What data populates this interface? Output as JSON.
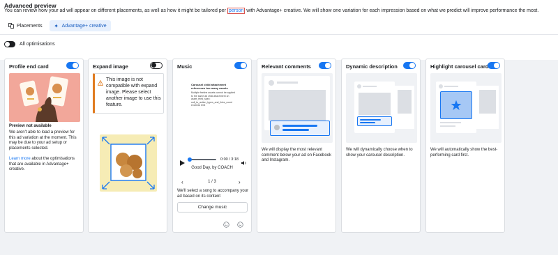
{
  "header": {
    "title": "Advanced preview",
    "description_before": "You can review how your ad will appear on different placements, as well as how it might be tailored per ",
    "description_highlight": "person",
    "description_after": " with Advantage+ creative. We will show one variation for each impression based on what we predict will improve performance the most."
  },
  "tabs": [
    {
      "label": "Placements",
      "icon": "placements-icon",
      "active": false
    },
    {
      "label": "Advantage+ creative",
      "icon": "sparkle-icon",
      "active": true
    }
  ],
  "all_optimisations": {
    "label": "All optimisations",
    "enabled": false
  },
  "cards": {
    "profile": {
      "title": "Profile end card",
      "enabled": true,
      "status": "Preview not available",
      "text": "We aren't able to load a preview for this ad variation at the moment. This may be due to your ad setup or placements selected.",
      "link": "Learn more",
      "text2": " about the optimisations that are available in Advantage+ creative."
    },
    "expand": {
      "title": "Expand image",
      "enabled": false,
      "warning": "This image is not compatible with expand image. Please select another image to use this feature."
    },
    "music": {
      "title": "Music",
      "enabled": true,
      "mini_text_1": "Carousel child attachment references too many assets",
      "mini_text_2": "Multiple feeline assets cannot be applied to the same ad child attachment on asset_feed_spec: call_to_action_types_and_links_count exceeds limit",
      "time": "0:00 / 3:18",
      "song": "Good Day, by COACH",
      "page": "1 / 3",
      "note": "We'll select a song to accompany your ad based on its content",
      "button": "Change music"
    },
    "comments": {
      "title": "Relevant comments",
      "enabled": true,
      "text": "We will display the most relevant comment below your ad on Facebook and Instagram."
    },
    "dynamic": {
      "title": "Dynamic description",
      "enabled": true,
      "text": "We will dynamically choose when to show your carousel description."
    },
    "carousel": {
      "title": "Highlight carousel card",
      "enabled": true,
      "text": "We will automatically show the best-performing card first."
    }
  },
  "colors": {
    "accent": "#1877f2",
    "tab_bg": "#e7f0fd",
    "warning": "#e07b1f",
    "link": "#1877f2"
  }
}
